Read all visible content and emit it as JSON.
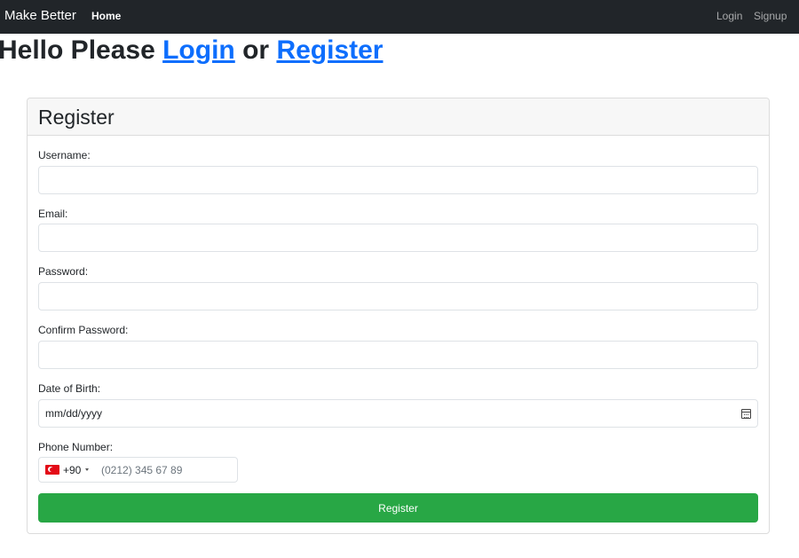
{
  "navbar": {
    "brand": "Make Better",
    "home": "Home",
    "login": "Login",
    "signup": "Signup"
  },
  "greeting": {
    "prefix": "Hello Please",
    "login_link": "Login",
    "middle": "or",
    "register_link": "Register"
  },
  "form": {
    "title": "Register",
    "username_label": "Username:",
    "email_label": "Email:",
    "password_label": "Password:",
    "confirm_label": "Confirm Password:",
    "dob_label": "Date of Birth:",
    "dob_placeholder": "mm/dd/yyyy",
    "phone_label": "Phone Number:",
    "phone_dial_code": "+90",
    "phone_placeholder": "(0212) 345 67 89",
    "submit_label": "Register"
  },
  "colors": {
    "navbar_bg": "#212529",
    "link": "#0d6efd",
    "submit_bg": "#28a745"
  },
  "icons": {
    "flag": "turkey-flag-icon",
    "calendar": "calendar-icon",
    "caret": "caret-down-icon"
  }
}
